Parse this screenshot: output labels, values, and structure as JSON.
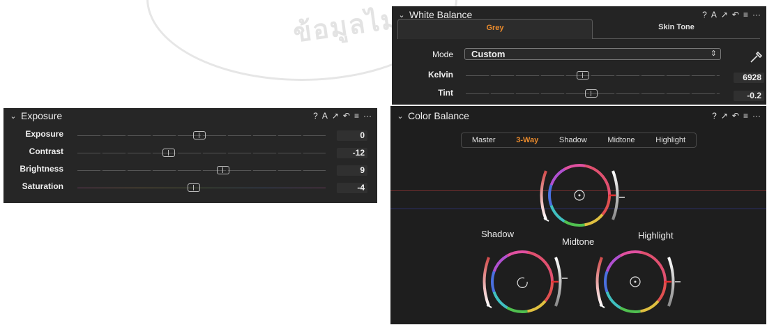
{
  "exposure_panel": {
    "title": "Exposure",
    "tools": [
      "?",
      "A",
      "↗",
      "↶",
      "≡",
      "···"
    ],
    "sliders": [
      {
        "label": "Exposure",
        "value": "0",
        "position": 0.5
      },
      {
        "label": "Contrast",
        "value": "-12",
        "position": 0.38
      },
      {
        "label": "Brightness",
        "value": "9",
        "position": 0.59
      },
      {
        "label": "Saturation",
        "value": "-4",
        "position": 0.47
      }
    ]
  },
  "white_balance_panel": {
    "title": "White Balance",
    "tools": [
      "?",
      "A",
      "↗",
      "↶",
      "≡",
      "···"
    ],
    "tabs": {
      "grey": "Grey",
      "skin_tone": "Skin Tone"
    },
    "mode_label": "Mode",
    "mode_value": "Custom",
    "sliders": [
      {
        "label": "Kelvin",
        "value": "6928",
        "position": 0.47
      },
      {
        "label": "Tint",
        "value": "-0.2",
        "position": 0.49
      }
    ]
  },
  "color_balance_panel": {
    "title": "Color Balance",
    "tools": [
      "?",
      "↗",
      "↶",
      "≡",
      "···"
    ],
    "segments": [
      "Master",
      "3-Way",
      "Shadow",
      "Midtone",
      "Highlight"
    ],
    "active_segment": "3-Way",
    "wheels": {
      "midtone": "Midtone",
      "shadow": "Shadow",
      "highlight": "Highlight"
    }
  },
  "watermark": "ข้อมูลไม่"
}
